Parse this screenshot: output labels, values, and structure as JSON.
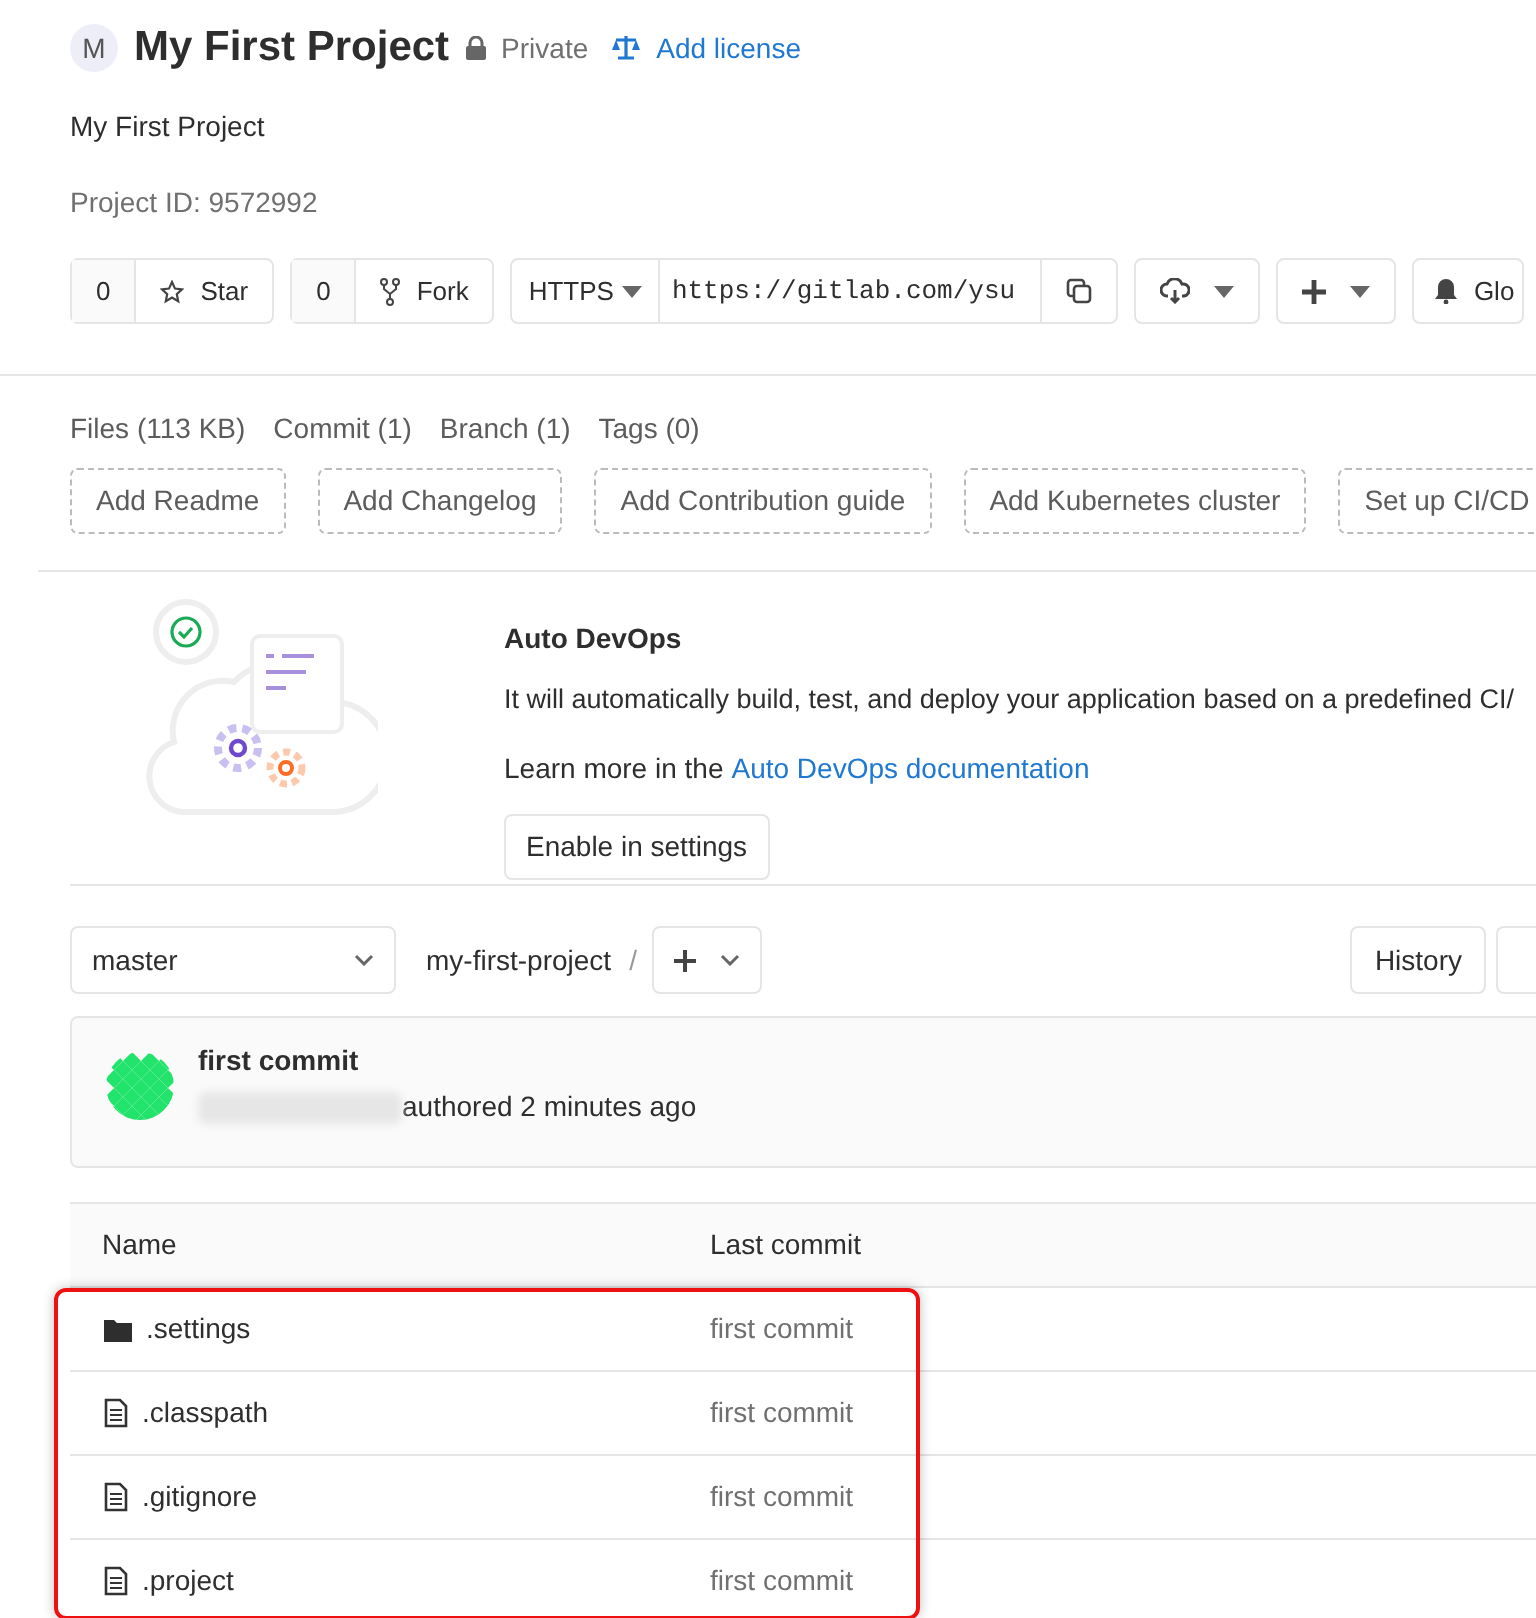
{
  "project": {
    "avatar_letter": "M",
    "title": "My First Project",
    "visibility": "Private",
    "license_link": "Add license",
    "description": "My First Project",
    "project_id": "Project ID: 9572992"
  },
  "actions": {
    "star": {
      "count": "0",
      "label": "Star"
    },
    "fork": {
      "count": "0",
      "label": "Fork"
    },
    "clone": {
      "protocol": "HTTPS",
      "url": "https://gitlab.com/ysu"
    },
    "notification": {
      "label": "Glo"
    }
  },
  "stats": [
    "Files (113 KB)",
    "Commit (1)",
    "Branch (1)",
    "Tags (0)"
  ],
  "quick_actions": [
    "Add Readme",
    "Add Changelog",
    "Add Contribution guide",
    "Add Kubernetes cluster",
    "Set up CI/CD"
  ],
  "auto_devops": {
    "title": "Auto DevOps",
    "description": "It will automatically build, test, and deploy your application based on a predefined CI/",
    "learn_more": "Learn more in the ",
    "link": "Auto DevOps documentation",
    "button": "Enable in settings"
  },
  "repo_bar": {
    "branch": "master",
    "path": "my-first-project",
    "separator": "/",
    "history": "History"
  },
  "last_commit": {
    "title": "first commit",
    "authored": "authored 2 minutes ago"
  },
  "table": {
    "columns": [
      "Name",
      "Last commit"
    ],
    "rows": [
      {
        "kind": "folder",
        "name": ".settings",
        "last_commit": "first commit",
        "highlighted": true
      },
      {
        "kind": "file",
        "name": ".classpath",
        "last_commit": "first commit",
        "highlighted": true
      },
      {
        "kind": "file",
        "name": ".gitignore",
        "last_commit": "first commit",
        "highlighted": true
      },
      {
        "kind": "file",
        "name": ".project",
        "last_commit": "first commit",
        "highlighted": true
      }
    ]
  }
}
